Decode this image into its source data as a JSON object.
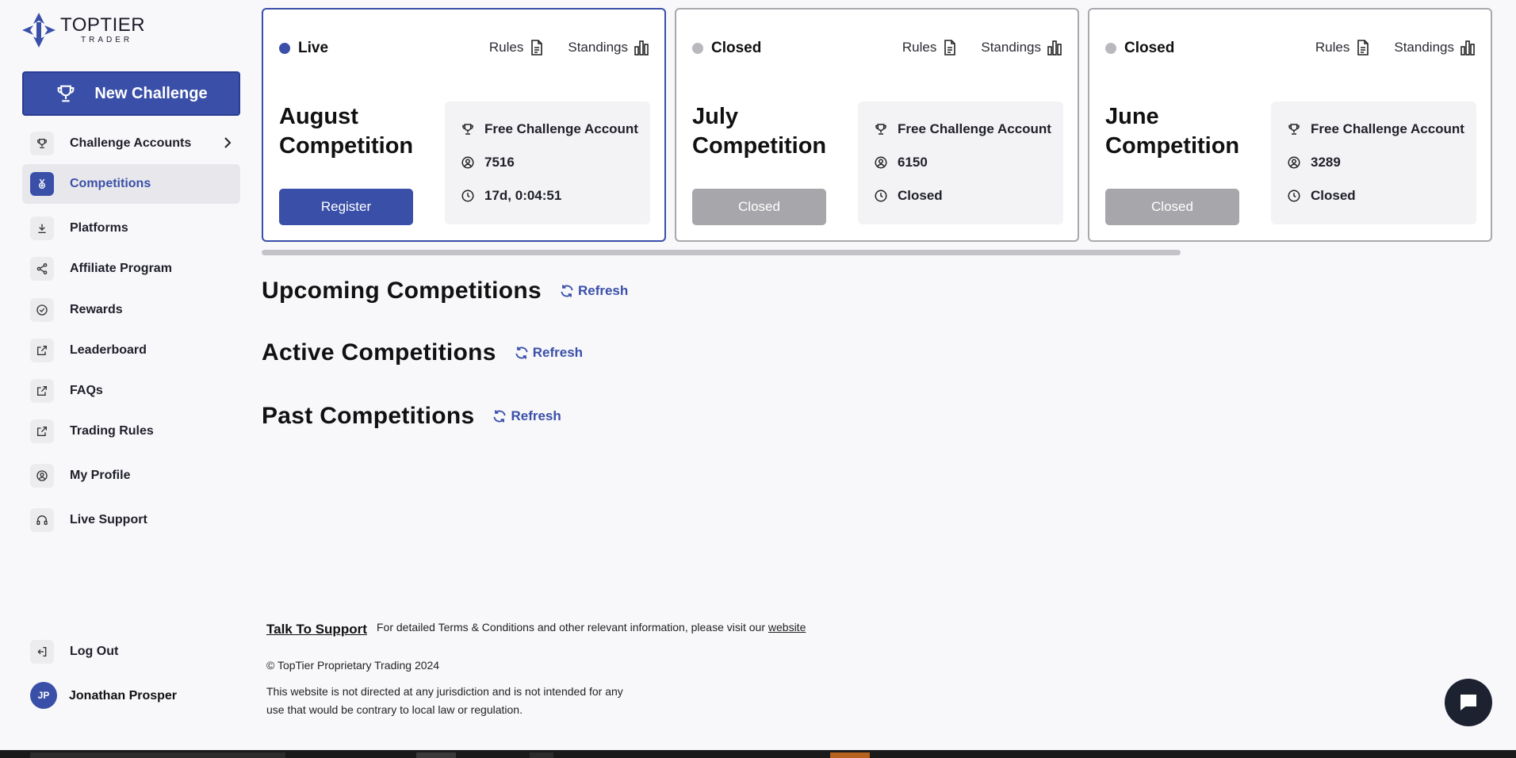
{
  "logo": {
    "name": "TOPTIER",
    "sub": "TRADER"
  },
  "new_challenge": "New Challenge",
  "nav": [
    {
      "label": "Challenge Accounts",
      "icon": "trophy-icon"
    },
    {
      "label": "Competitions",
      "icon": "medal-icon",
      "active": true
    },
    {
      "label": "Platforms",
      "icon": "download-icon"
    },
    {
      "label": "Affiliate Program",
      "icon": "share-icon"
    },
    {
      "label": "Rewards",
      "icon": "check-circle-icon"
    },
    {
      "label": "Leaderboard",
      "icon": "external-link-icon"
    },
    {
      "label": "FAQs",
      "icon": "external-link-icon"
    },
    {
      "label": "Trading Rules",
      "icon": "external-link-icon"
    },
    {
      "label": "My Profile",
      "icon": "user-circle-icon"
    },
    {
      "label": "Live Support",
      "icon": "headset-icon"
    }
  ],
  "logout": "Log Out",
  "user": {
    "initials": "JP",
    "name": "Jonathan Prosper"
  },
  "cards": [
    {
      "status": "Live",
      "rules": "Rules",
      "standings": "Standings",
      "title": "August Competition",
      "button": "Register",
      "account": "Free Challenge Account",
      "participants": "7516",
      "time": "17d, 0:04:51"
    },
    {
      "status": "Closed",
      "rules": "Rules",
      "standings": "Standings",
      "title": "July Competition",
      "button": "Closed",
      "account": "Free Challenge Account",
      "participants": "6150",
      "time": "Closed"
    },
    {
      "status": "Closed",
      "rules": "Rules",
      "standings": "Standings",
      "title": "June Competition",
      "button": "Closed",
      "account": "Free Challenge Account",
      "participants": "3289",
      "time": "Closed"
    }
  ],
  "sections": {
    "upcoming": "Upcoming Competitions",
    "active": "Active Competitions",
    "past": "Past Competitions",
    "refresh": "Refresh"
  },
  "footer": {
    "talk": "Talk To Support",
    "terms": "For detailed Terms & Conditions and other relevant information, please visit our",
    "website": "website",
    "copyright": "© TopTier Proprietary Trading 2024",
    "disclaimer": "This website is not directed at any jurisdiction and is not intended for any use that would be contrary to local law or regulation."
  },
  "colors": {
    "accent": "#3a4fa8",
    "closed": "#a7a7ab"
  }
}
